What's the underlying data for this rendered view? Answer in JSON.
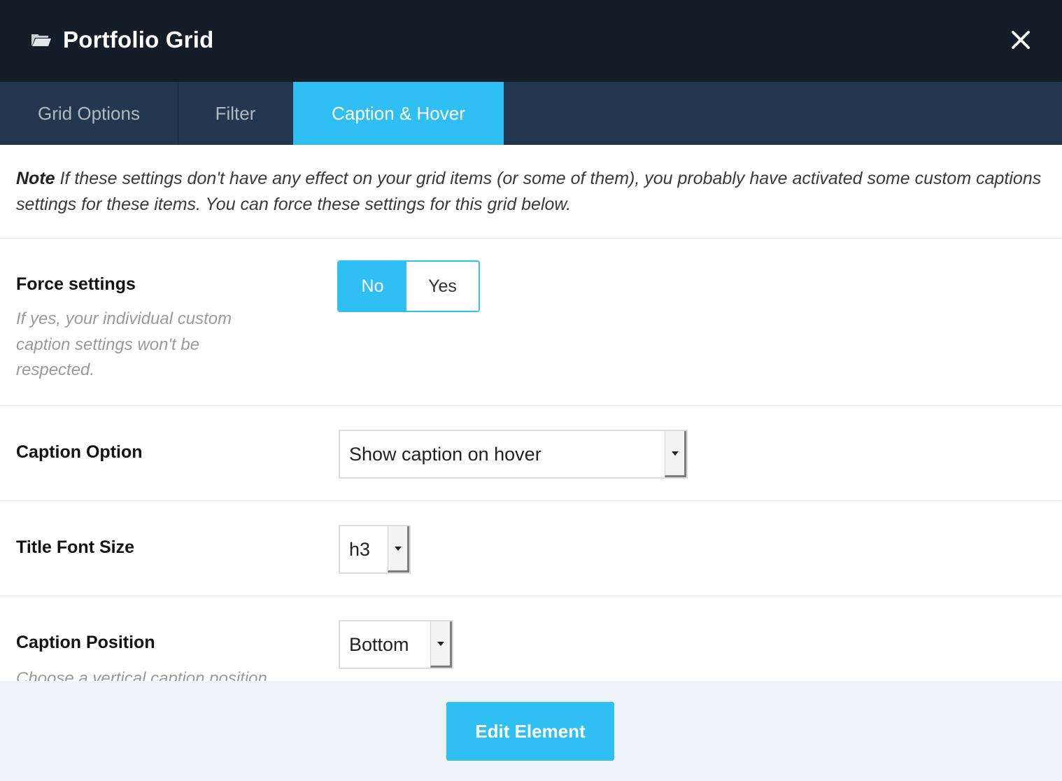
{
  "header": {
    "title": "Portfolio Grid",
    "icon": "folder-open-icon",
    "close_icon": "close-icon"
  },
  "tabs": [
    {
      "label": "Grid Options",
      "active": false
    },
    {
      "label": "Filter",
      "active": false
    },
    {
      "label": "Caption & Hover",
      "active": true
    }
  ],
  "note": {
    "bold": "Note",
    "text": " If these settings don't have any effect on your grid items (or some of them), you probably have activated some custom captions settings for these items. You can force these settings for this grid below."
  },
  "settings": {
    "force": {
      "label": "Force settings",
      "description": "If yes, your individual custom caption settings won't be respected.",
      "options": [
        "No",
        "Yes"
      ],
      "selected": "No"
    },
    "caption_option": {
      "label": "Caption Option",
      "value": "Show caption on hover"
    },
    "title_font_size": {
      "label": "Title Font Size",
      "value": "h3"
    },
    "caption_position": {
      "label": "Caption Position",
      "value": "Bottom",
      "description": "Choose a vertical caption position"
    }
  },
  "footer": {
    "button_label": "Edit Element"
  },
  "colors": {
    "header_bg": "#141d28",
    "tabs_bg": "#23384e",
    "accent": "#30bff2",
    "footer_bg": "#eef3f8"
  }
}
